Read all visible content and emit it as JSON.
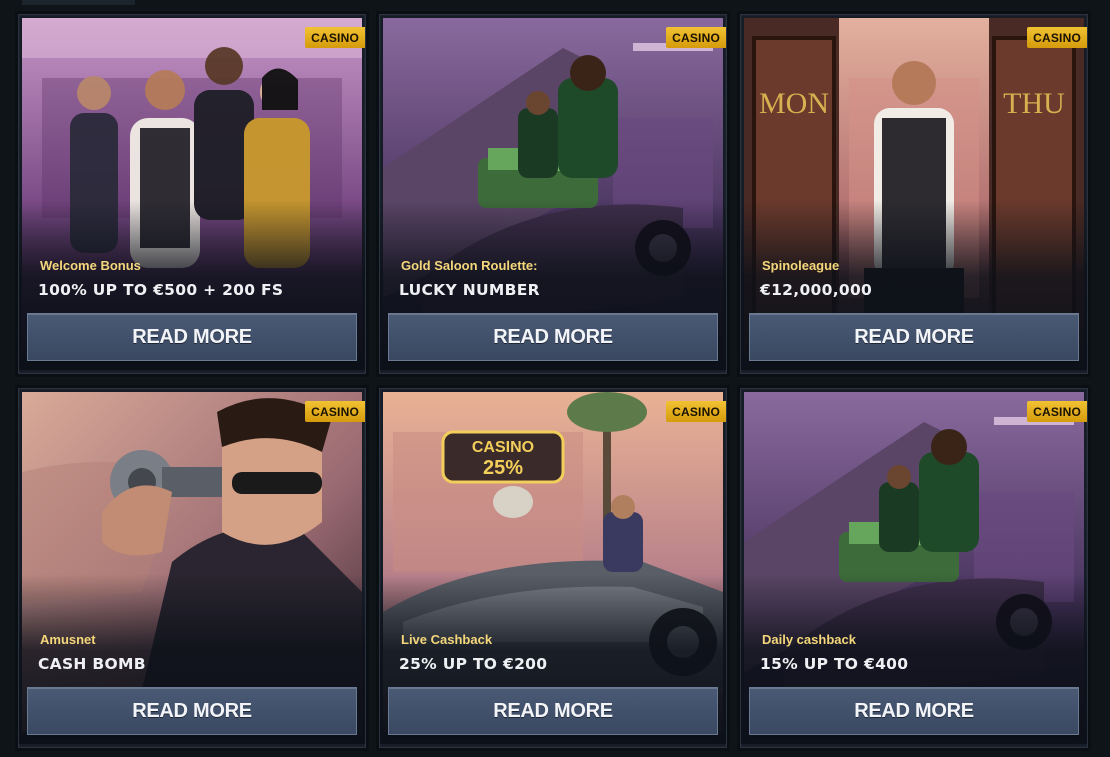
{
  "promotions": [
    {
      "badge": "CASINO",
      "subtitle": "Welcome Bonus",
      "title": "100% UP TO €500 + 200 FS",
      "button_label": "READ MORE",
      "art": "gang-group",
      "palette": {
        "bg1": "#b07ab0",
        "bg2": "#4a2a5c",
        "accent": "#d8a030"
      }
    },
    {
      "badge": "CASINO",
      "subtitle": "Gold Saloon Roulette:",
      "title": "LUCKY NUMBER",
      "button_label": "READ MORE",
      "art": "car-trunk-money",
      "palette": {
        "bg1": "#7a5a8e",
        "bg2": "#2f2040",
        "accent": "#4aa870"
      }
    },
    {
      "badge": "CASINO",
      "subtitle": "Spinoleague",
      "title": "€12,000,000",
      "button_label": "READ MORE",
      "art": "casino-doors",
      "palette": {
        "bg1": "#d29a88",
        "bg2": "#3a2028",
        "accent": "#c9a060"
      },
      "door_left": "MON",
      "door_right": "THU"
    },
    {
      "badge": "CASINO",
      "subtitle": "Amusnet",
      "title": "CASH BOMB",
      "button_label": "READ MORE",
      "art": "gangster-revolver",
      "palette": {
        "bg1": "#d6a796",
        "bg2": "#3a2630",
        "accent": "#c6a040"
      }
    },
    {
      "badge": "CASINO",
      "subtitle": "Live Cashback",
      "title": "25% UP TO €200",
      "button_label": "READ MORE",
      "art": "convertible-dog",
      "palette": {
        "bg1": "#e3a98c",
        "bg2": "#6a4a5a",
        "accent": "#f2cf5a"
      },
      "sign_top": "CASINO",
      "sign_bottom": "25%"
    },
    {
      "badge": "CASINO",
      "subtitle": "Daily cashback",
      "title": "15% UP TO €400",
      "button_label": "READ MORE",
      "art": "car-trunk-money",
      "palette": {
        "bg1": "#7a5a8e",
        "bg2": "#2f2040",
        "accent": "#4aa870"
      }
    }
  ]
}
